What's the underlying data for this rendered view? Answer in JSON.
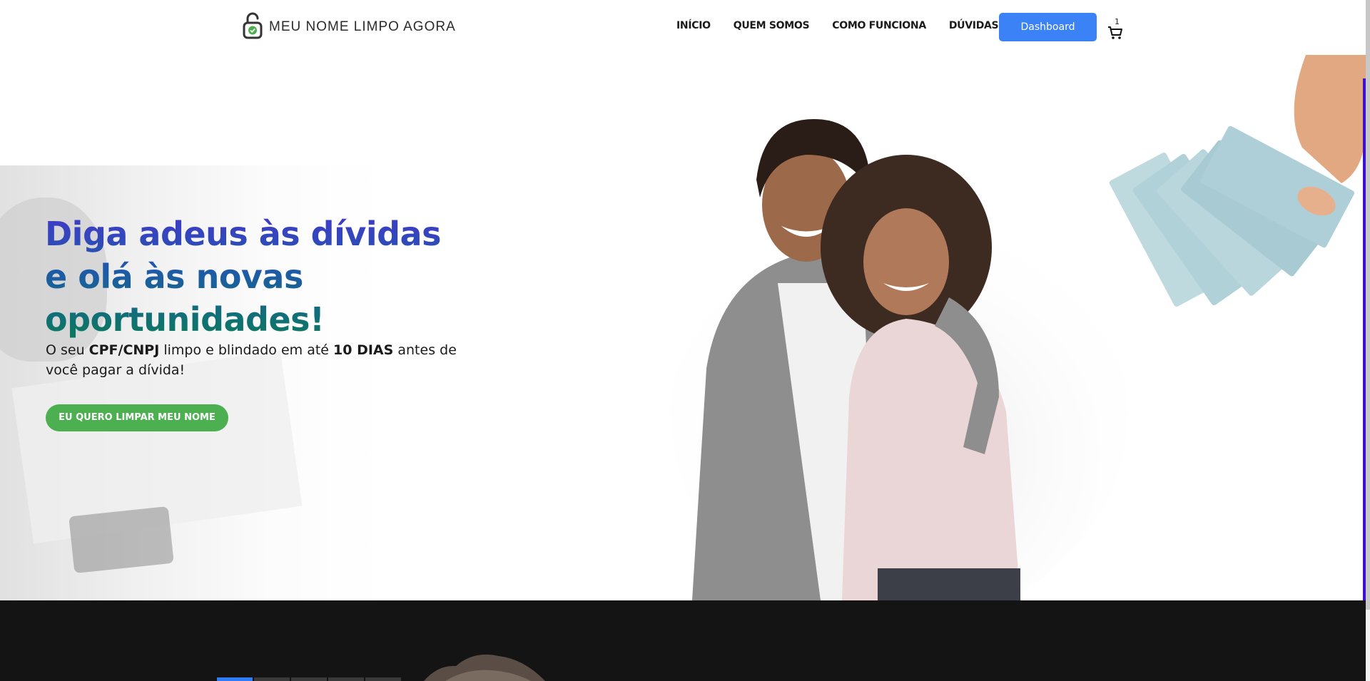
{
  "brand": {
    "name": "MEU NOME LIMPO AGORA",
    "logo_icon": "unlocked-padlock-check-icon",
    "accent_green": "#4caf50"
  },
  "nav": {
    "items": [
      {
        "label": "INÍCIO"
      },
      {
        "label": "QUEM SOMOS"
      },
      {
        "label": "COMO FUNCIONA"
      },
      {
        "label": "DÚVIDAS"
      }
    ],
    "dashboard_label": "Dashboard",
    "dashboard_color": "#3b82f6",
    "cart_count": "1",
    "cart_icon": "shopping-cart-icon"
  },
  "hero": {
    "headline": "Diga adeus às dívidas e olá às novas oportunidades!",
    "sub_part1": "O seu ",
    "sub_bold1": "CPF/CNPJ",
    "sub_part2": " limpo e blindado em até ",
    "sub_bold2": "10 DIAS",
    "sub_part3": " antes de você pagar a dívida!",
    "cta_label": "EU QUERO LIMPAR MEU NOME",
    "headline_gradient": [
      "#4338ca",
      "#1e5aa8",
      "#0b7a5c"
    ]
  },
  "carousel": {
    "slides": 5,
    "active_index": 0,
    "active_color": "#2f7cf6"
  }
}
